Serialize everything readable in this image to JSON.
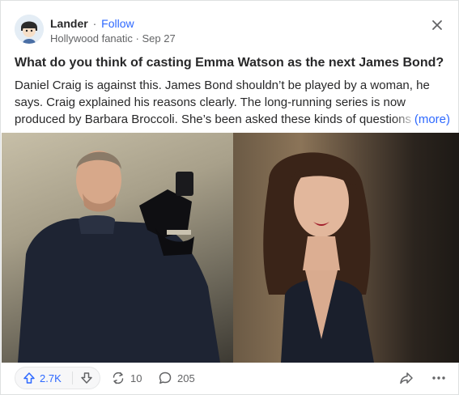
{
  "post": {
    "author": "Lander",
    "separator": "·",
    "follow_label": "Follow",
    "credential": "Hollywood fanatic",
    "date": "Sep 27",
    "question": "What do you think of casting Emma Watson as the next James Bond?",
    "body_lines": [
      "Daniel Craig is against this. James Bond shouldn’t be played by a woman, he",
      "says. Craig explained his reasons clearly. The long-running series is now",
      "produced by Barbara Broccoli. She’s been asked these kinds of questions f"
    ],
    "more_label": "(more)"
  },
  "actions": {
    "upvotes": "2.7K",
    "shares": "10",
    "comments": "205"
  },
  "colors": {
    "accent": "#2e69ff",
    "text": "#282829",
    "muted": "#636466"
  },
  "icons": [
    "avatar-icon",
    "close-icon",
    "upvote-arrow-icon",
    "downvote-arrow-icon",
    "share-cycle-icon",
    "comment-bubble-icon",
    "forward-share-icon",
    "more-dots-icon"
  ]
}
